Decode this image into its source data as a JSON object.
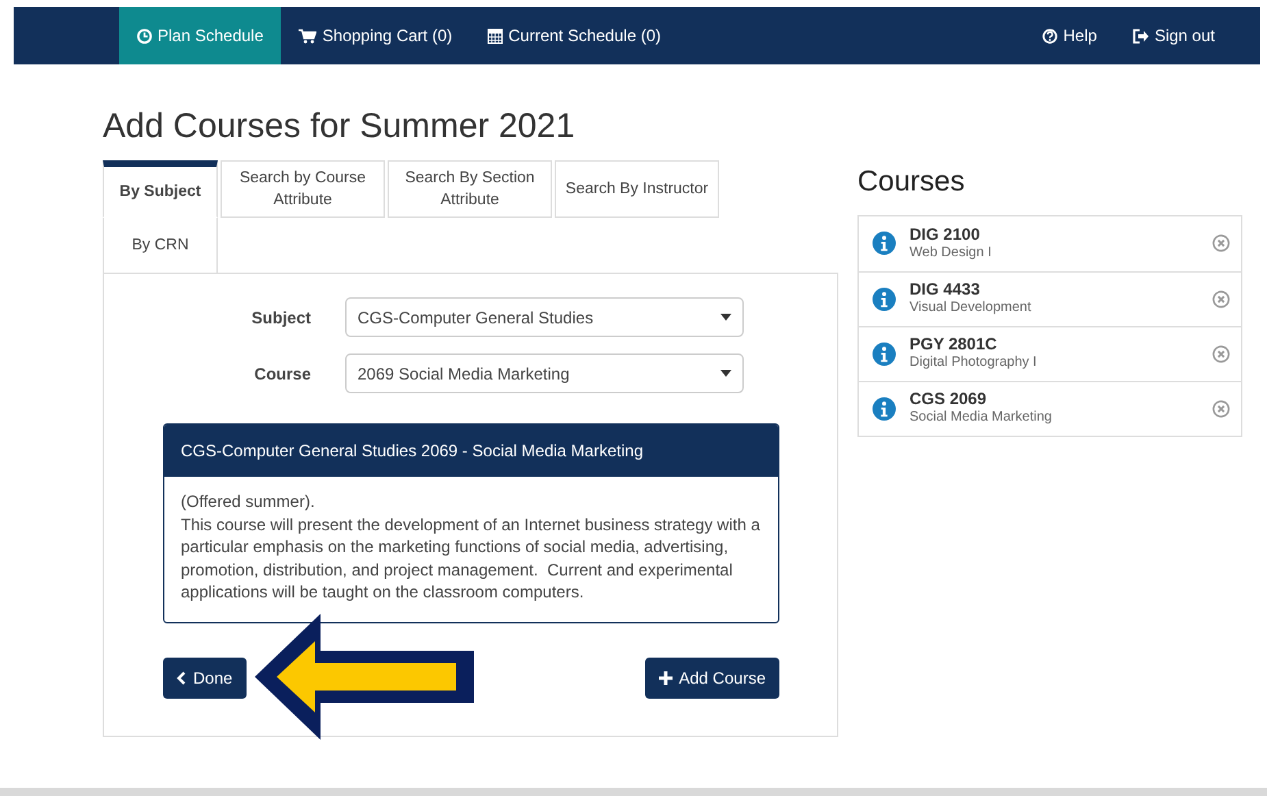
{
  "nav": {
    "items": [
      {
        "kind": "clock",
        "label": "Plan Schedule",
        "selected": true
      },
      {
        "kind": "cart",
        "label": "Shopping Cart (0)",
        "selected": false
      },
      {
        "kind": "calendar",
        "label": "Current Schedule (0)",
        "selected": false
      }
    ],
    "right_items": [
      {
        "kind": "help",
        "label": "Help"
      },
      {
        "kind": "signout",
        "label": "Sign out"
      }
    ]
  },
  "title": "Add Courses for Summer 2021",
  "tabs": [
    {
      "label": "By Subject",
      "selected": true
    },
    {
      "label": "Search by Course Attribute",
      "selected": false
    },
    {
      "label": "Search By Section Attribute",
      "selected": false
    },
    {
      "label": "Search By Instructor",
      "selected": false
    },
    {
      "label": "By CRN",
      "selected": false
    }
  ],
  "form": [
    {
      "label": "Subject",
      "value": "CGS-Computer General Studies"
    },
    {
      "label": "Course",
      "value": "2069 Social Media Marketing"
    }
  ],
  "description": {
    "heading": "CGS-Computer General Studies 2069 - Social Media Marketing",
    "text": "(Offered summer).\nThis course will present the development of an Internet business strategy with a particular emphasis on the marketing functions of social media, advertising, promotion, distribution, and project management.  Current and experimental applications will be taught on the classroom computers."
  },
  "buttons": {
    "done": "Done",
    "add": "Add Course"
  },
  "courses": {
    "title": "Courses",
    "items": [
      {
        "code": "DIG 2100",
        "name": "Web Design I"
      },
      {
        "code": "DIG 4433",
        "name": "Visual Development"
      },
      {
        "code": "PGY 2801C",
        "name": "Digital Photography I"
      },
      {
        "code": "CGS 2069",
        "name": "Social Media Marketing"
      }
    ]
  }
}
